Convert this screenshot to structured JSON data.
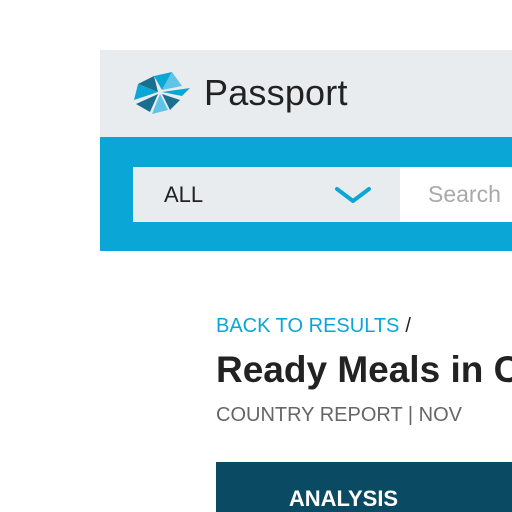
{
  "header": {
    "logo_icon": "passport-logo-icon",
    "brand_name": "Passport"
  },
  "search": {
    "scope_value": "ALL",
    "scope_icon": "chevron-down-icon",
    "placeholder": "Search"
  },
  "breadcrumb": {
    "back_label": "BACK TO RESULTS",
    "separator": "/"
  },
  "report": {
    "title": "Ready Meals in C",
    "meta": "COUNTRY REPORT | NOV"
  },
  "tabs": [
    {
      "label": "ANALYSIS"
    }
  ],
  "colors": {
    "brand_bar": "#e8ecef",
    "search_band": "#0aa7d6",
    "link": "#0aa7d6",
    "tab_bar": "#0b4a63",
    "title": "#222222"
  }
}
